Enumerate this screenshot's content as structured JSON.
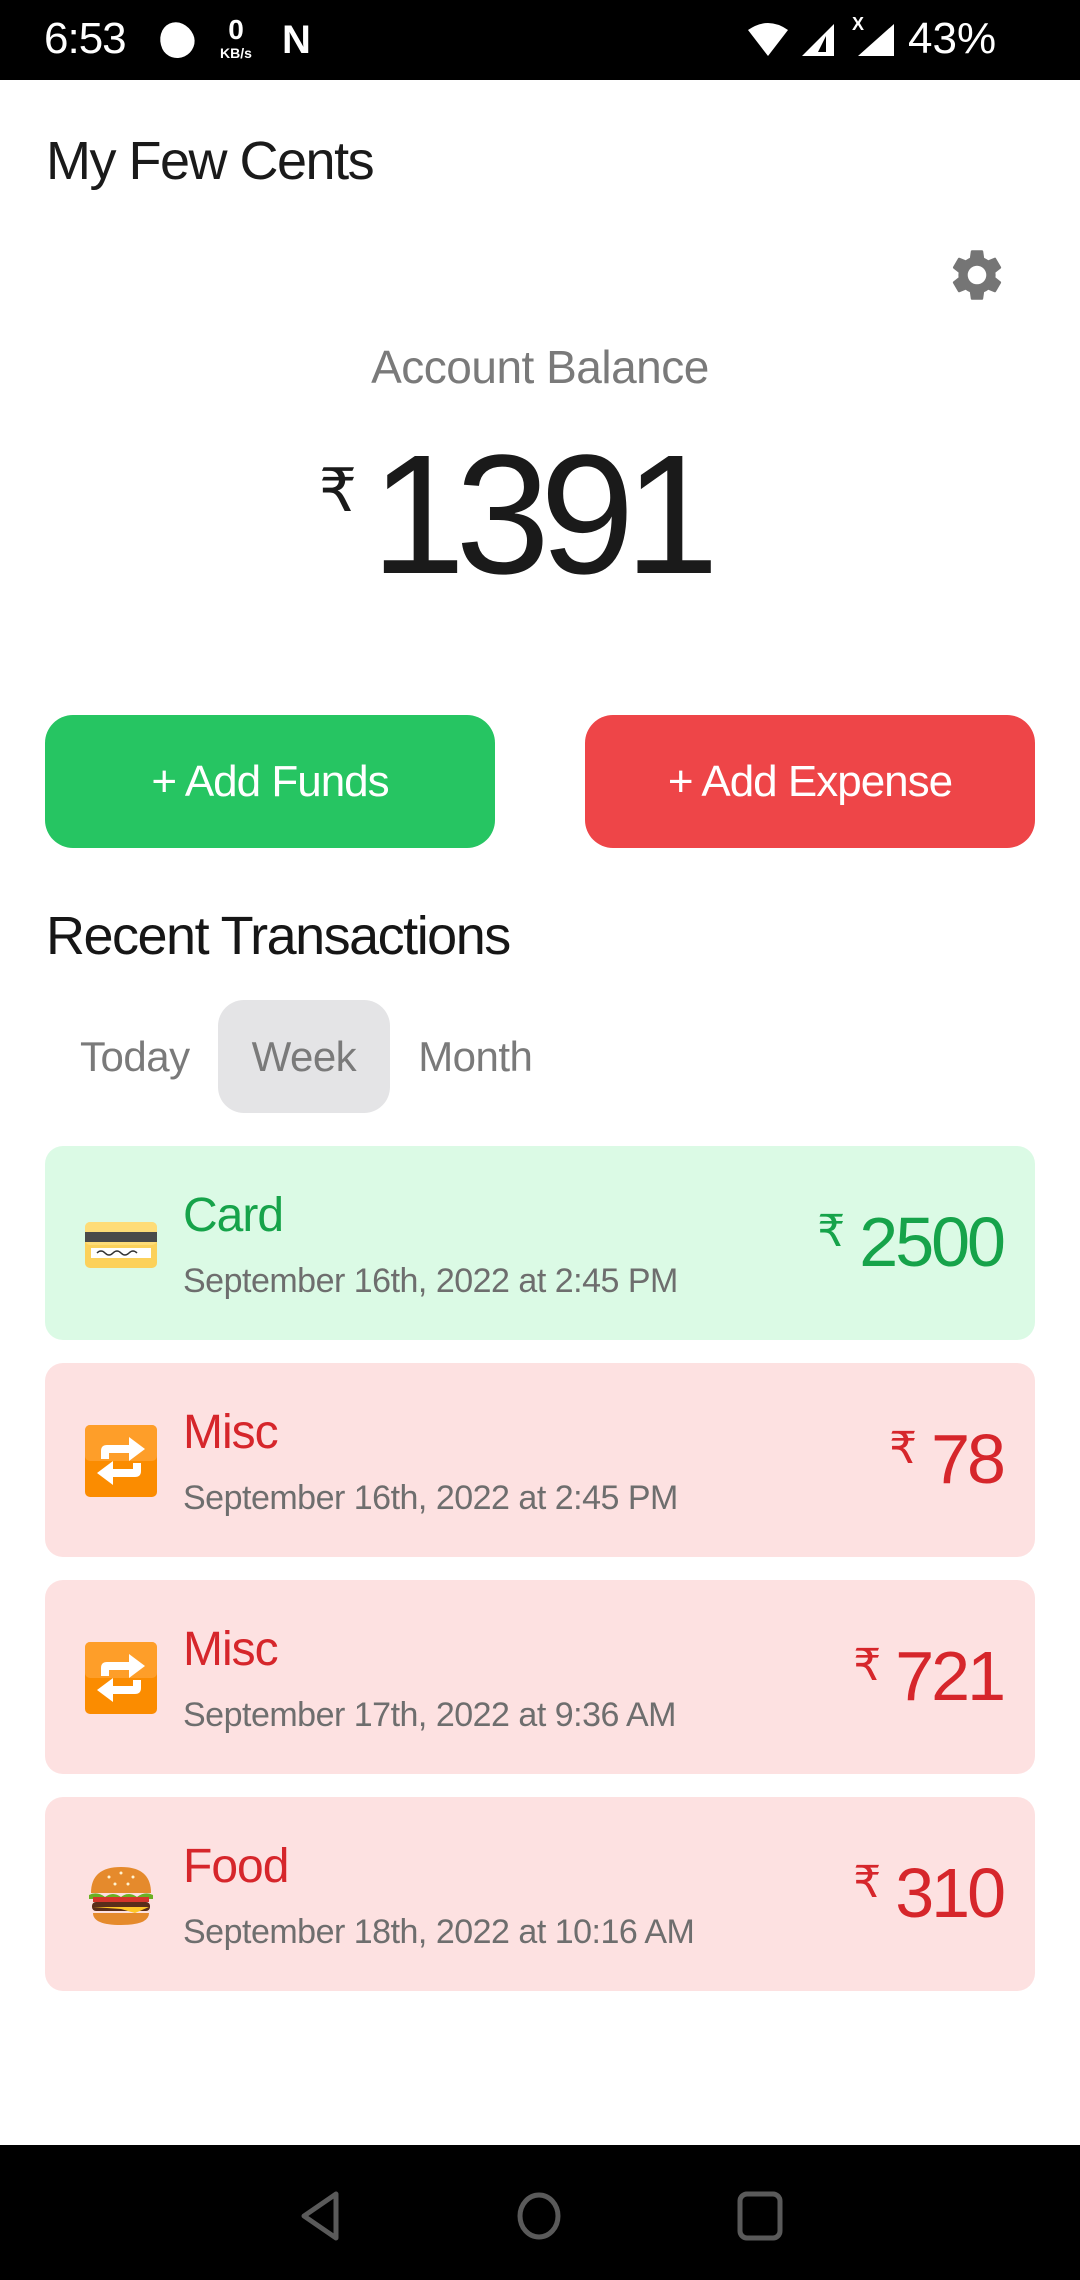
{
  "status_bar": {
    "time": "6:53",
    "net_speed_value": "0",
    "net_speed_unit": "KB/s",
    "notification_app": "N",
    "signal_label": "X",
    "battery": "43%"
  },
  "app": {
    "title": "My Few Cents"
  },
  "balance": {
    "label": "Account Balance",
    "currency": "₹",
    "amount": "1391"
  },
  "actions": {
    "add_funds": "+ Add Funds",
    "add_expense": "+ Add Expense"
  },
  "colors": {
    "income": "#16a34a",
    "expense": "#d6262b",
    "add_funds_bg": "#26c562",
    "add_expense_bg": "#ee4548",
    "income_card_bg": "#dbfae5",
    "expense_card_bg": "#fde1e1"
  },
  "recent": {
    "title": "Recent Transactions",
    "tabs": [
      {
        "label": "Today",
        "active": false
      },
      {
        "label": "Week",
        "active": true
      },
      {
        "label": "Month",
        "active": false
      }
    ],
    "transactions": [
      {
        "type": "income",
        "icon": "credit-card-icon",
        "category": "Card",
        "date": "September 16th, 2022 at 2:45 PM",
        "currency": "₹",
        "amount": "2500"
      },
      {
        "type": "expense",
        "icon": "repeat-icon",
        "category": "Misc",
        "date": "September 16th, 2022 at 2:45 PM",
        "currency": "₹",
        "amount": "78"
      },
      {
        "type": "expense",
        "icon": "repeat-icon",
        "category": "Misc",
        "date": "September 17th, 2022 at 9:36 AM",
        "currency": "₹",
        "amount": "721"
      },
      {
        "type": "expense",
        "icon": "hamburger-icon",
        "category": "Food",
        "date": "September 18th, 2022 at 10:16 AM",
        "currency": "₹",
        "amount": "310"
      }
    ]
  }
}
